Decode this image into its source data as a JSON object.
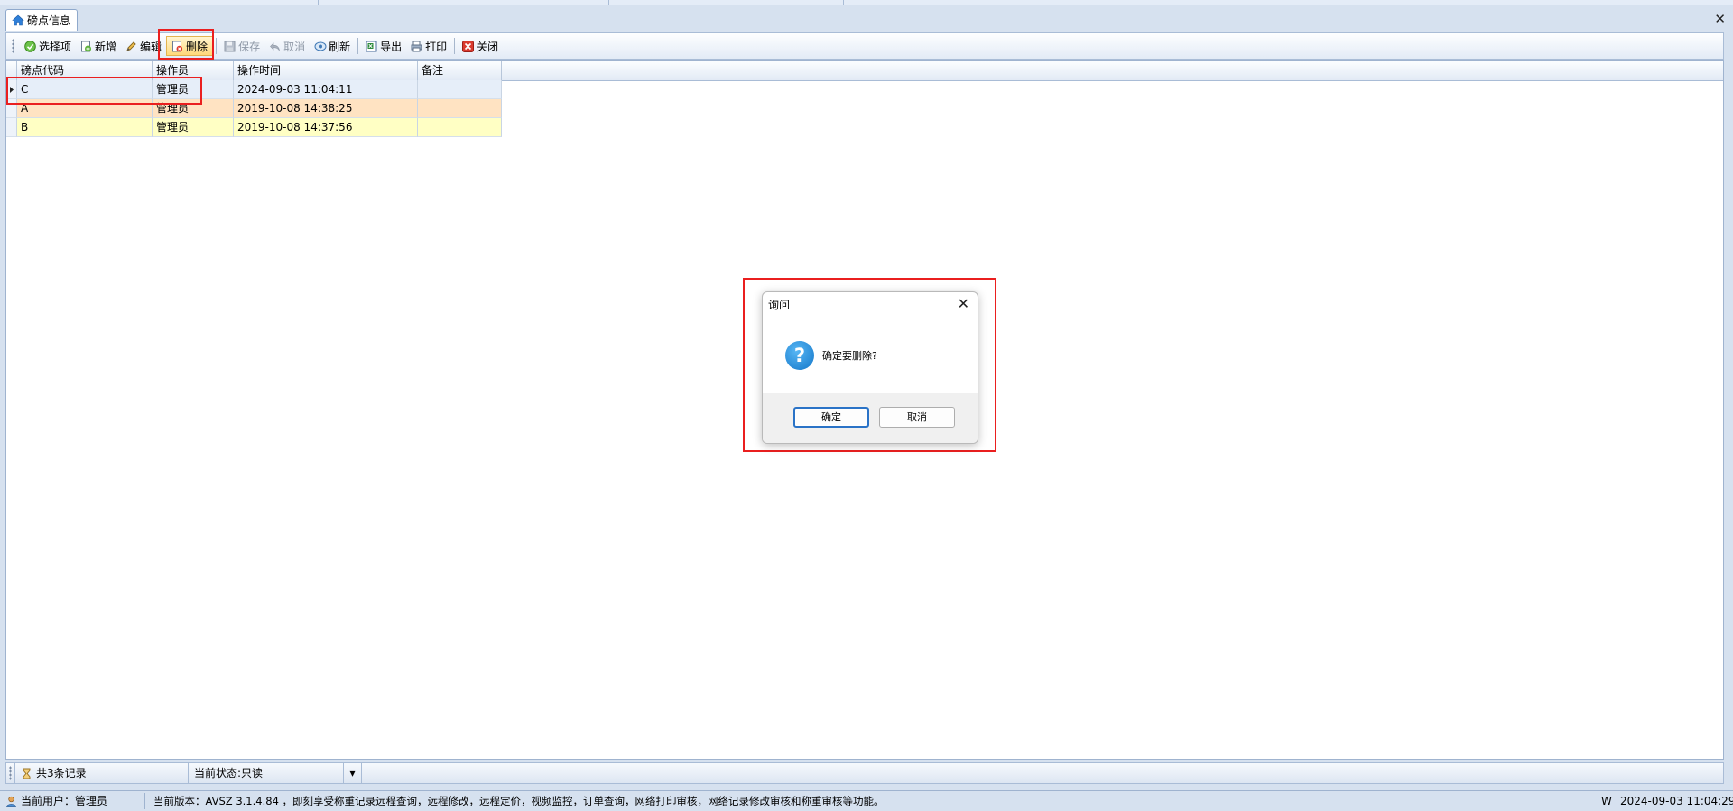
{
  "tab": {
    "label": "磅点信息"
  },
  "toolbar": {
    "select_items": "选择项",
    "add": "新增",
    "edit": "编辑",
    "delete": "删除",
    "save": "保存",
    "cancel": "取消",
    "refresh": "刷新",
    "export": "导出",
    "print": "打印",
    "close": "关闭"
  },
  "grid": {
    "columns": [
      "磅点代码",
      "操作员",
      "操作时间",
      "备注"
    ],
    "rows": [
      {
        "code": "C",
        "operator": "管理员",
        "time": "2024-09-03 11:04:11",
        "note": "",
        "color": "#e6eef9"
      },
      {
        "code": "A",
        "operator": "管理员",
        "time": "2019-10-08 14:38:25",
        "note": "",
        "color": "#ffe3c2"
      },
      {
        "code": "B",
        "operator": "管理员",
        "time": "2019-10-08 14:37:56",
        "note": "",
        "color": "#ffffc4"
      }
    ]
  },
  "dialog": {
    "title": "询问",
    "message": "确定要删除?",
    "ok": "确定",
    "cancel": "取消"
  },
  "grid_status": {
    "records": "共3条记录",
    "state": "当前状态:只读"
  },
  "app_status": {
    "user": "当前用户：管理员",
    "version": "当前版本：AVSZ 3.1.4.84 ，即刻享受称重记录远程查询，远程修改，远程定价，视频监控，订单查询，网络打印审核，网络记录修改审核和称重审核等功能。",
    "w": "W",
    "datetime": "2024-09-03 11:04:29"
  },
  "colors": {
    "highlight": "#ea1f1f",
    "accent": "#2a73c7"
  }
}
